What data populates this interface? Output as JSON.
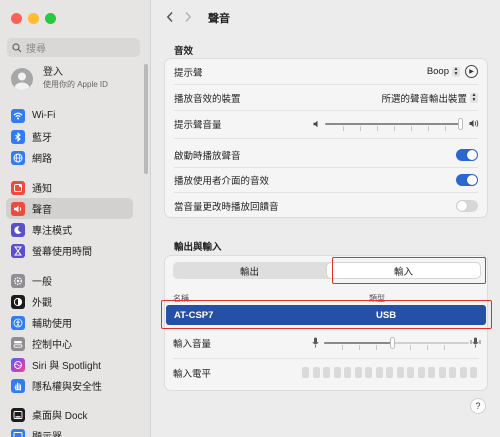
{
  "window": {
    "title": "聲音"
  },
  "sidebar": {
    "search_placeholder": "搜尋",
    "account": {
      "title": "登入",
      "subtitle": "使用你的 Apple ID"
    },
    "items": [
      {
        "label": "Wi-Fi",
        "icon": "wifi-icon",
        "color": "#2f7cf6",
        "active": false
      },
      {
        "label": "藍牙",
        "icon": "bluetooth-icon",
        "color": "#2f7cf6",
        "active": false
      },
      {
        "label": "網路",
        "icon": "globe-icon",
        "color": "#2f7cf6",
        "active": false
      },
      {
        "label": "通知",
        "icon": "bell-icon",
        "color": "#f04a3c",
        "active": false
      },
      {
        "label": "聲音",
        "icon": "speaker-icon",
        "color": "#f04a3c",
        "active": true
      },
      {
        "label": "專注模式",
        "icon": "moon-icon",
        "color": "#5a4fcf",
        "active": false
      },
      {
        "label": "螢幕使用時間",
        "icon": "hourglass-icon",
        "color": "#5a4fcf",
        "active": false
      },
      {
        "label": "一般",
        "icon": "gear-icon",
        "color": "#8e8e93",
        "active": false
      },
      {
        "label": "外觀",
        "icon": "appearance-icon",
        "color": "#1c1c1e",
        "active": false
      },
      {
        "label": "輔助使用",
        "icon": "accessibility-icon",
        "color": "#2f7cf6",
        "active": false
      },
      {
        "label": "控制中心",
        "icon": "control-center-icon",
        "color": "#8e8e93",
        "active": false
      },
      {
        "label": "Siri 與 Spotlight",
        "icon": "siri-icon",
        "color": "#6a3fd8",
        "active": false
      },
      {
        "label": "隱私權與安全性",
        "icon": "hand-icon",
        "color": "#2f7cf6",
        "active": false
      },
      {
        "label": "桌面與 Dock",
        "icon": "dock-icon",
        "color": "#1c1c1e",
        "active": false
      },
      {
        "label": "顯示器",
        "icon": "display-icon",
        "color": "#2f7cf6",
        "active": false
      }
    ]
  },
  "sound_effects": {
    "section_title": "音效",
    "alert_sound_label": "提示聲",
    "alert_sound_value": "Boop",
    "play_device_label": "播放音效的裝置",
    "play_device_value": "所選的聲音輸出裝置",
    "alert_volume_label": "提示聲音量",
    "alert_volume_level": 0.97,
    "startup_sound_label": "啟動時播放聲音",
    "startup_sound_on": true,
    "ui_sound_label": "播放使用者介面的音效",
    "ui_sound_on": true,
    "feedback_label": "當音量更改時播放回饋音",
    "feedback_on": false
  },
  "io": {
    "section_title": "輸出與輸入",
    "tab_output": "輸出",
    "tab_input": "輸入",
    "col_name": "名稱",
    "col_type": "類型",
    "device_name": "AT-CSP7",
    "device_type": "USB",
    "input_volume_label": "輸入音量",
    "input_volume_level": 0.5,
    "input_level_label": "輸入電平"
  },
  "help_label": "?"
}
